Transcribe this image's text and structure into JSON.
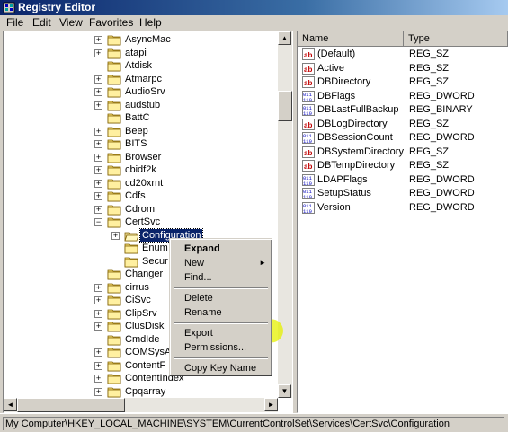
{
  "window": {
    "title": "Registry Editor"
  },
  "menu": [
    "File",
    "Edit",
    "View",
    "Favorites",
    "Help"
  ],
  "tree": {
    "rows": [
      {
        "label": "AsyncMac",
        "expander": "+"
      },
      {
        "label": "atapi",
        "expander": "+"
      },
      {
        "label": "Atdisk",
        "expander": ""
      },
      {
        "label": "Atmarpc",
        "expander": "+"
      },
      {
        "label": "AudioSrv",
        "expander": "+"
      },
      {
        "label": "audstub",
        "expander": "+"
      },
      {
        "label": "BattC",
        "expander": ""
      },
      {
        "label": "Beep",
        "expander": "+"
      },
      {
        "label": "BITS",
        "expander": "+"
      },
      {
        "label": "Browser",
        "expander": "+"
      },
      {
        "label": "cbidf2k",
        "expander": "+"
      },
      {
        "label": "cd20xrnt",
        "expander": "+"
      },
      {
        "label": "Cdfs",
        "expander": "+"
      },
      {
        "label": "Cdrom",
        "expander": "+"
      },
      {
        "label": "CertSvc",
        "expander": "-"
      },
      {
        "label": "Configuration",
        "expander": "+",
        "level": 2,
        "selected": true
      },
      {
        "label": "Enum",
        "expander": "",
        "level": 2
      },
      {
        "label": "Secur",
        "expander": "",
        "level": 2
      },
      {
        "label": "Changer",
        "expander": ""
      },
      {
        "label": "cirrus",
        "expander": "+"
      },
      {
        "label": "CiSvc",
        "expander": "+"
      },
      {
        "label": "ClipSrv",
        "expander": "+"
      },
      {
        "label": "ClusDisk",
        "expander": "+"
      },
      {
        "label": "CmdIde",
        "expander": ""
      },
      {
        "label": "COMSysA",
        "expander": "+"
      },
      {
        "label": "ContentF",
        "expander": "+"
      },
      {
        "label": "ContentIndex",
        "expander": "+"
      },
      {
        "label": "Cpqarray",
        "expander": "+"
      }
    ]
  },
  "list": {
    "columns": {
      "name": "Name",
      "type": "Type"
    },
    "rows": [
      {
        "name": "(Default)",
        "type": "REG_SZ",
        "icon": "string-value-icon"
      },
      {
        "name": "Active",
        "type": "REG_SZ",
        "icon": "string-value-icon"
      },
      {
        "name": "DBDirectory",
        "type": "REG_SZ",
        "icon": "string-value-icon"
      },
      {
        "name": "DBFlags",
        "type": "REG_DWORD",
        "icon": "binary-value-icon"
      },
      {
        "name": "DBLastFullBackup",
        "type": "REG_BINARY",
        "icon": "binary-value-icon"
      },
      {
        "name": "DBLogDirectory",
        "type": "REG_SZ",
        "icon": "string-value-icon"
      },
      {
        "name": "DBSessionCount",
        "type": "REG_DWORD",
        "icon": "binary-value-icon"
      },
      {
        "name": "DBSystemDirectory",
        "type": "REG_SZ",
        "icon": "string-value-icon"
      },
      {
        "name": "DBTempDirectory",
        "type": "REG_SZ",
        "icon": "string-value-icon"
      },
      {
        "name": "LDAPFlags",
        "type": "REG_DWORD",
        "icon": "binary-value-icon"
      },
      {
        "name": "SetupStatus",
        "type": "REG_DWORD",
        "icon": "binary-value-icon"
      },
      {
        "name": "Version",
        "type": "REG_DWORD",
        "icon": "binary-value-icon"
      }
    ]
  },
  "context_menu": {
    "expand": "Expand",
    "new": "New",
    "find": "Find...",
    "delete": "Delete",
    "rename": "Rename",
    "export": "Export",
    "permissions": "Permissions...",
    "copy_key_name": "Copy Key Name"
  },
  "status": {
    "path": "My Computer\\HKEY_LOCAL_MACHINE\\SYSTEM\\CurrentControlSet\\Services\\CertSvc\\Configuration"
  },
  "colors": {
    "title_bar": "#0a246a",
    "selection": "#0a246a",
    "highlight": "#e6f000"
  }
}
